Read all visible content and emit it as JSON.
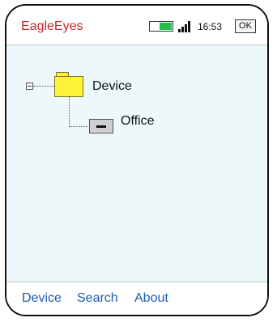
{
  "header": {
    "app_title": "EagleEyes",
    "time": "16:53",
    "ok_label": "OK",
    "battery_level": 0.55,
    "colors": {
      "title": "#c8232e",
      "battery": "#22c24a"
    }
  },
  "tree": {
    "root": {
      "label": "Device",
      "icon": "folder-icon",
      "expanded": true
    },
    "children": [
      {
        "label": "Office",
        "icon": "camera-device-icon"
      }
    ]
  },
  "menu": {
    "items": [
      "Device",
      "Search",
      "About"
    ],
    "color": "#1a5fb0"
  }
}
